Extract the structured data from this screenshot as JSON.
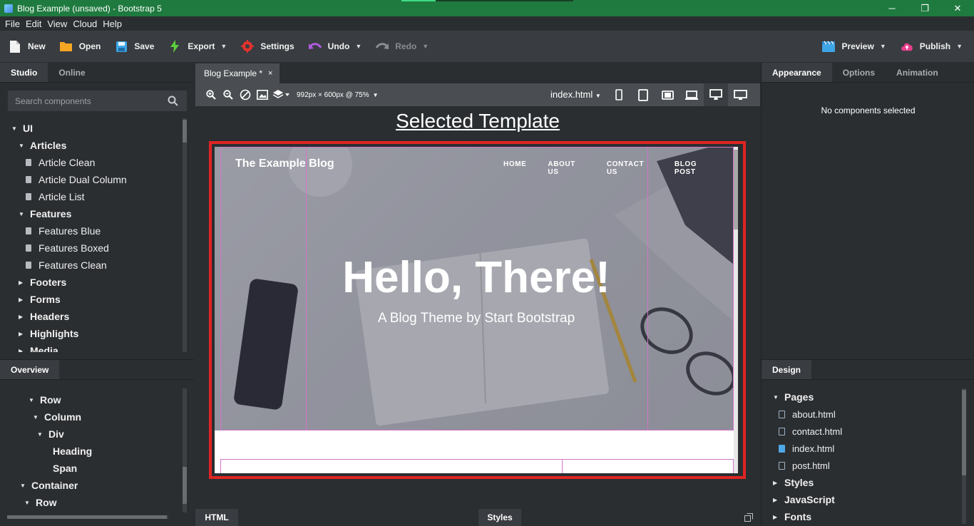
{
  "window": {
    "title": "Blog Example (unsaved) - Bootstrap 5",
    "minimize": "─",
    "restore": "❐",
    "close": "✕"
  },
  "menu": [
    "File",
    "Edit",
    "View",
    "Cloud",
    "Help"
  ],
  "toolbar": {
    "new": "New",
    "open": "Open",
    "save": "Save",
    "export": "Export",
    "settings": "Settings",
    "undo": "Undo",
    "redo": "Redo",
    "preview": "Preview",
    "publish": "Publish"
  },
  "left_panel": {
    "tabs": [
      "Studio",
      "Online"
    ],
    "search_placeholder": "Search components",
    "tree": {
      "ui": "UI",
      "articles": "Articles",
      "article_clean": "Article Clean",
      "article_dual": "Article Dual Column",
      "article_list": "Article List",
      "features": "Features",
      "features_blue": "Features Blue",
      "features_boxed": "Features Boxed",
      "features_clean": "Features Clean",
      "footers": "Footers",
      "forms": "Forms",
      "headers": "Headers",
      "highlights": "Highlights",
      "media": "Media"
    }
  },
  "overview": {
    "tab": "Overview",
    "items": {
      "row1": "Row",
      "column": "Column",
      "div": "Div",
      "heading": "Heading",
      "span": "Span",
      "container": "Container",
      "row2": "Row"
    }
  },
  "document": {
    "tab": "Blog Example *",
    "close": "×",
    "dimensions": "992px × 600px @ 75%",
    "page": "index.html",
    "selected_template": "Selected Template"
  },
  "preview": {
    "brand": "The Example Blog",
    "nav": [
      "HOME",
      "ABOUT US",
      "CONTACT US",
      "BLOG POST"
    ],
    "heading": "Hello, There!",
    "subheading": "A Blog Theme by Start Bootstrap"
  },
  "bottom_tabs": {
    "html": "HTML",
    "styles": "Styles"
  },
  "right_panel": {
    "tabs": [
      "Appearance",
      "Options",
      "Animation"
    ],
    "empty": "No components selected"
  },
  "design": {
    "tab": "Design",
    "pages_label": "Pages",
    "pages": [
      "about.html",
      "contact.html",
      "index.html",
      "post.html"
    ],
    "styles": "Styles",
    "javascript": "JavaScript",
    "fonts": "Fonts"
  }
}
